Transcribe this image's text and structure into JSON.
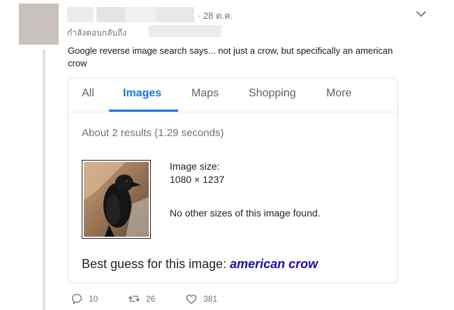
{
  "tweet": {
    "date": "· 28 ต.ค.",
    "replying_to_label": "กำลังตอบกลับถึง",
    "text": "Google reverse image search says... not just a crow, but specifically an american crow"
  },
  "card": {
    "tabs": [
      {
        "label": "All",
        "active": false
      },
      {
        "label": "Images",
        "active": true
      },
      {
        "label": "Maps",
        "active": false
      },
      {
        "label": "Shopping",
        "active": false
      },
      {
        "label": "More",
        "active": false
      }
    ],
    "results_text": "About 2 results (1.29 seconds)",
    "image_size_label": "Image size:",
    "image_size_value": "1080 × 1237",
    "no_other_sizes": "No other sizes of this image found.",
    "best_guess_prefix": "Best guess for this image: ",
    "best_guess_link": "american crow"
  },
  "actions": {
    "replies": "10",
    "retweets": "26",
    "likes": "381"
  },
  "colors": {
    "accent": "#1a73e8",
    "link": "#1a0dab",
    "muted": "#657786"
  },
  "icons": [
    "chevron-down-icon",
    "reply-icon",
    "retweet-icon",
    "heart-icon"
  ]
}
